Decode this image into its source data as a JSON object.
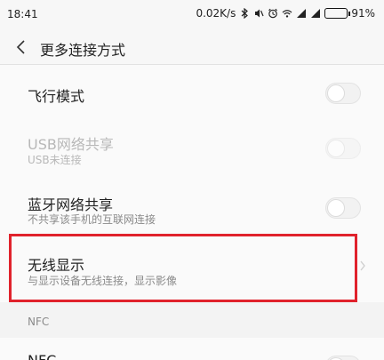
{
  "status_bar": {
    "time": "18:41",
    "speed": "0.02K/s",
    "battery_percent": "91%",
    "battery_level": 0.91,
    "icons": [
      "bluetooth-icon",
      "mute-icon",
      "alarm-icon",
      "wifi-icon",
      "signal-icon",
      "signal-icon",
      "battery-icon"
    ]
  },
  "header": {
    "title": "更多连接方式"
  },
  "settings": {
    "airplane_mode": {
      "title": "飞行模式",
      "enabled": false
    },
    "usb_tether": {
      "title": "USB网络共享",
      "subtitle": "USB未连接",
      "enabled": false,
      "disabled": true
    },
    "bt_tether": {
      "title": "蓝牙网络共享",
      "subtitle": "不共享该手机的互联网连接",
      "enabled": false
    },
    "wireless_display": {
      "title": "无线显示",
      "subtitle": "与显示设备无线连接，显示影像"
    }
  },
  "nfc_section": {
    "label": "NFC",
    "nfc_item": {
      "title": "NFC",
      "enabled": false
    }
  },
  "colors": {
    "highlight": "#e0222c",
    "battery": "#4cd964"
  }
}
